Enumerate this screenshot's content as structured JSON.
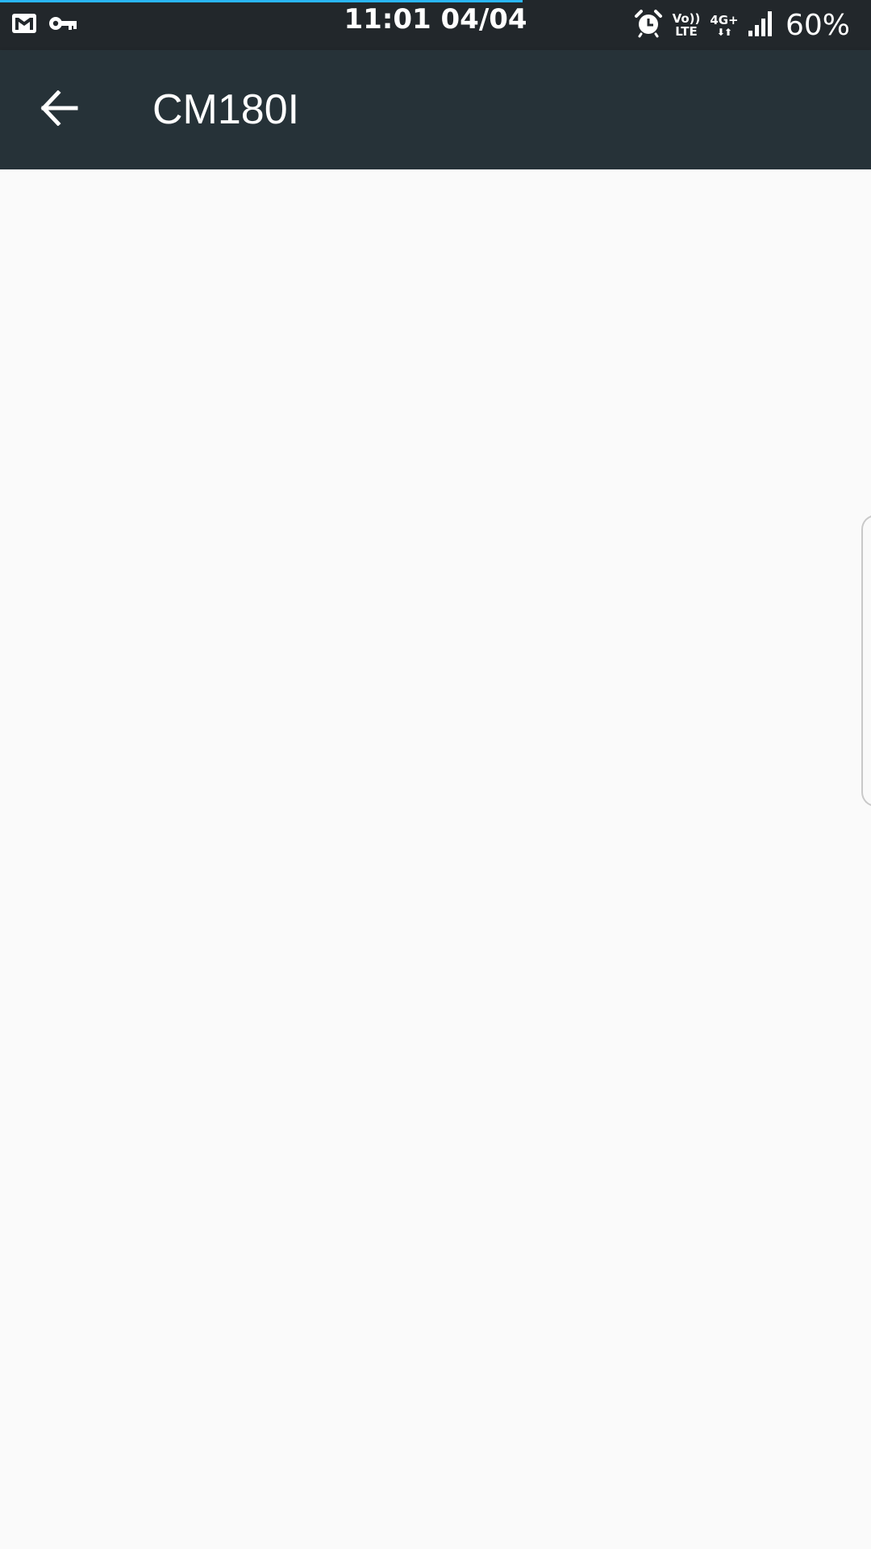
{
  "status_bar": {
    "time": "11:01",
    "date": "04/04",
    "icons_left": [
      "gmail-icon",
      "vpn-key-icon"
    ],
    "icons_right": [
      "alarm-icon",
      "volte-icon",
      "4g-plus-icon",
      "signal-icon"
    ],
    "volte_top": "Vo))",
    "volte_bottom": "LTE",
    "network_type": "4G+",
    "network_arrows": "⬇⬆",
    "battery": "60%",
    "load_progress": 0.6
  },
  "app_bar": {
    "title": "CM180I",
    "background": "#263238"
  },
  "colors": {
    "status_bar": "#22272b",
    "progress_accent": "#29b6f6",
    "content_background": "#fafafa"
  }
}
